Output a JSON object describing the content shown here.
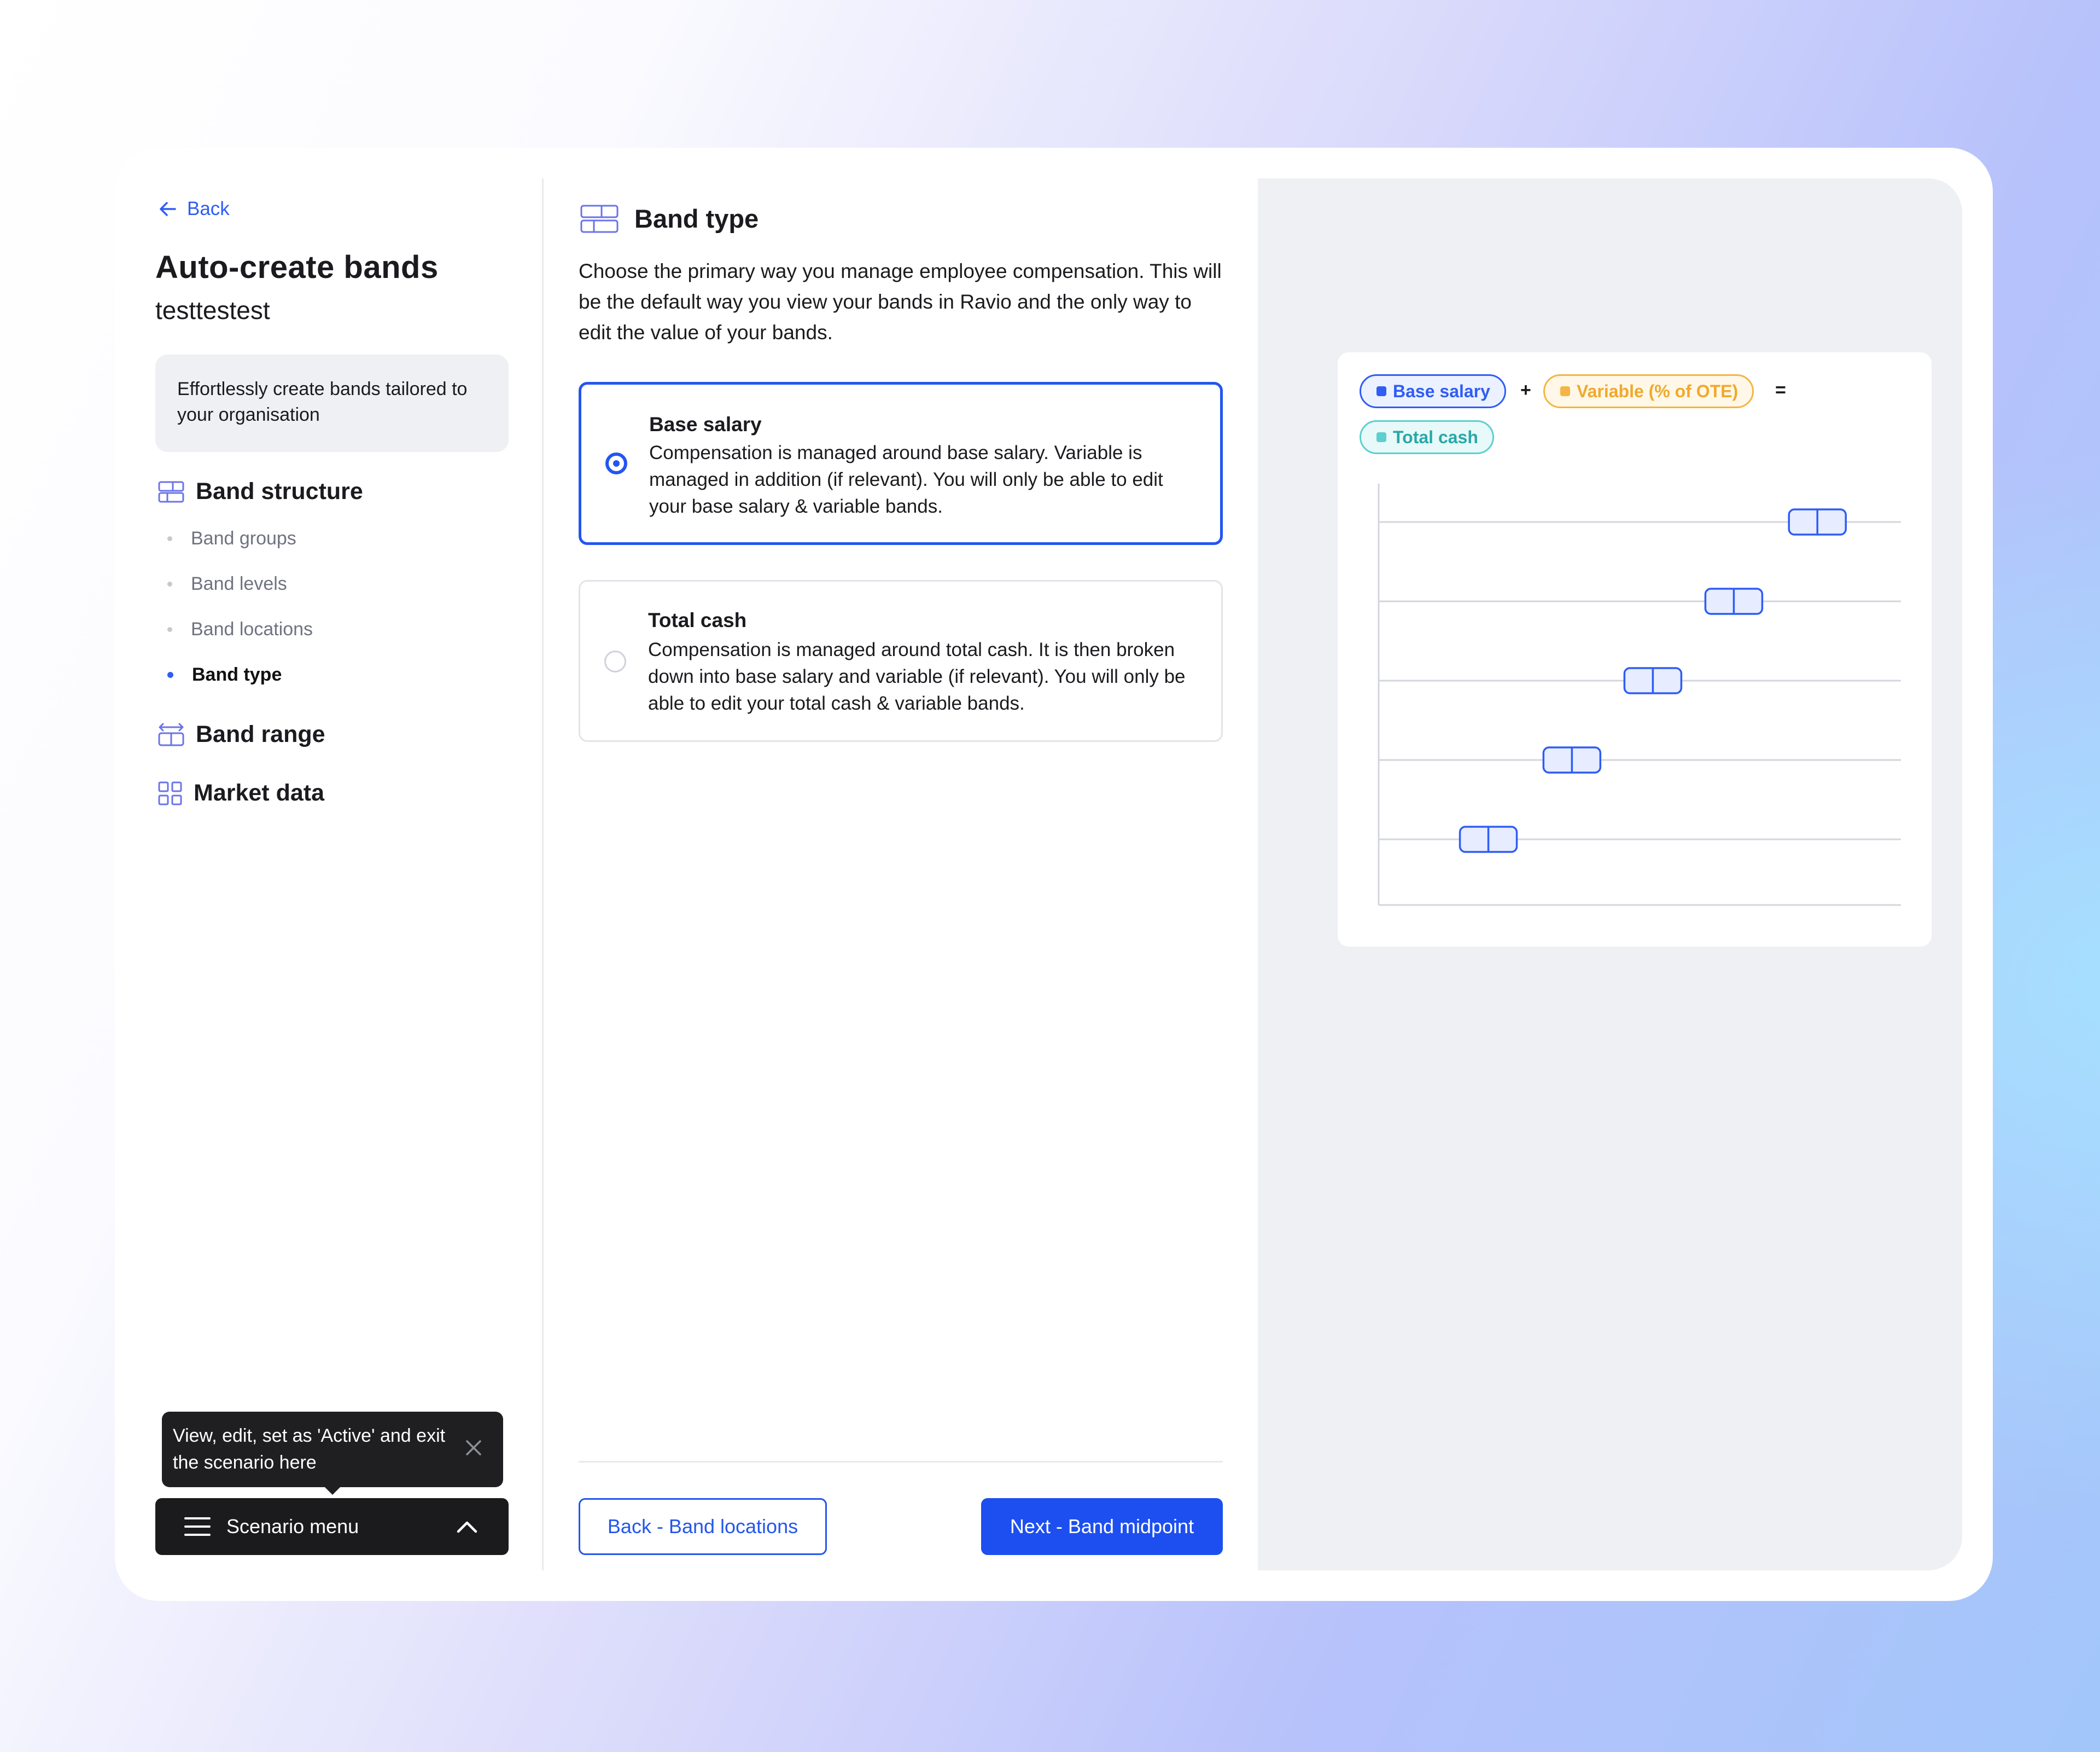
{
  "nav": {
    "back_label": "Back"
  },
  "page": {
    "title": "Auto-create bands",
    "scenario_name": "testtestest"
  },
  "intro": {
    "text": "Effortlessly create bands tailored to your organisation"
  },
  "sidebar": {
    "sections": [
      {
        "label": "Band structure",
        "icon": "band-structure-icon"
      },
      {
        "label": "Band range",
        "icon": "band-range-icon"
      },
      {
        "label": "Market data",
        "icon": "grid-icon"
      }
    ],
    "sub_items": [
      {
        "label": "Band groups",
        "active": false
      },
      {
        "label": "Band levels",
        "active": false
      },
      {
        "label": "Band locations",
        "active": false
      },
      {
        "label": "Band type",
        "active": true
      }
    ]
  },
  "tooltip": {
    "text": "View, edit, set as 'Active' and exit the scenario here",
    "close_icon": "close-icon"
  },
  "scenario_menu": {
    "label": "Scenario menu",
    "menu_icon": "hamburger-icon",
    "toggle_icon": "chevron-up-icon"
  },
  "main": {
    "title": "Band type",
    "description": "Choose the primary way you manage employee compensation. This will be the default way you view your bands in Ravio and the only way to edit the value of your bands.",
    "options": [
      {
        "title": "Base salary",
        "description": "Compensation is managed around base salary. Variable is managed in addition (if relevant). You will only be able to edit your base salary & variable bands.",
        "selected": true
      },
      {
        "title": "Total cash",
        "description": "Compensation is managed around total cash. It is then broken down into base salary and variable (if relevant). You will only be able to edit your total cash & variable bands.",
        "selected": false
      }
    ]
  },
  "footer": {
    "back_label": "Back - Band locations",
    "next_label": "Next - Band midpoint"
  },
  "preview": {
    "legend": {
      "base": "Base salary",
      "plus": "+",
      "variable": "Variable (% of OTE)",
      "equals": "=",
      "total": "Total cash"
    }
  },
  "colors": {
    "accent": "#2456ee",
    "base_salary": "#2f5df5",
    "variable": "#f4b544",
    "total_cash": "#5ecfcf",
    "dark": "#1b1b1d"
  },
  "chart_data": {
    "type": "box",
    "note_rows": 5,
    "rows": [
      {
        "position": 0.84
      },
      {
        "position": 0.68
      },
      {
        "position": 0.525
      },
      {
        "position": 0.37
      },
      {
        "position": 0.21
      }
    ]
  }
}
